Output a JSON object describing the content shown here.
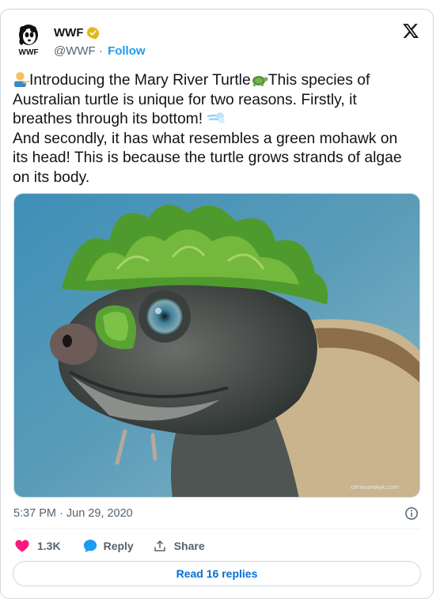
{
  "author": {
    "display_name": "WWF",
    "handle": "@WWF",
    "separator": " · ",
    "follow_label": "Follow",
    "verified_badge_color": "#e2b719"
  },
  "tweet": {
    "lines": [
      "Introducing the Mary River Turtle",
      "This species of",
      "Australian turtle is unique for two reasons. Firstly, it",
      "breathes through its bottom!",
      "And secondly, it has what resembles a green mohawk on",
      "its head! This is because the turtle grows strands of algae",
      "on its body."
    ],
    "emojis": [
      "person-pointing-emoji",
      "turtle-emoji",
      "dash-emoji"
    ]
  },
  "media": {
    "alt": "Mary River Turtle with green algae mohawk",
    "watermark": "chrisvanwyk.com"
  },
  "meta": {
    "timestamp": "5:37 PM · Jun 29, 2020"
  },
  "actions": {
    "like_count": "1.3K",
    "reply_label": "Reply",
    "share_label": "Share",
    "read_replies_label": "Read 16 replies"
  },
  "colors": {
    "link_blue": "#1d9bf0",
    "like_pink": "#f91880",
    "reply_blue": "#1d9bf0",
    "text_primary": "#0f1419",
    "text_secondary": "#536471"
  }
}
